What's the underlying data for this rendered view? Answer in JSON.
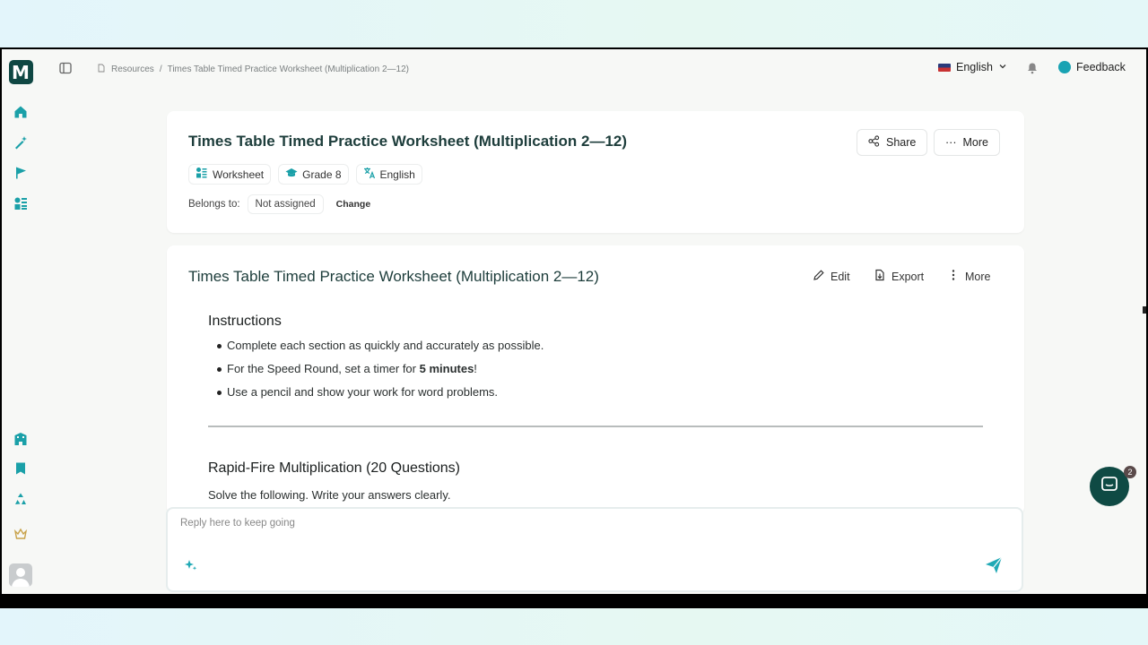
{
  "app": {
    "logo_letter": "M"
  },
  "breadcrumb": {
    "root": "Resources",
    "separator": "/",
    "current": "Times Table Timed Practice Worksheet (Multiplication 2—12)"
  },
  "topbar": {
    "language": "English",
    "feedback": "Feedback"
  },
  "resource_card": {
    "title": "Times Table Timed Practice Worksheet (Multiplication 2—12)",
    "share_label": "Share",
    "more_label": "More",
    "tags": [
      {
        "icon": "worksheet-icon",
        "label": "Worksheet"
      },
      {
        "icon": "graduation-cap-icon",
        "label": "Grade 8"
      },
      {
        "icon": "translate-icon",
        "label": "English"
      }
    ],
    "belongs_label": "Belongs to:",
    "belongs_value": "Not assigned",
    "change_label": "Change"
  },
  "document_card": {
    "title": "Times Table Timed Practice Worksheet (Multiplication 2—12)",
    "edit_label": "Edit",
    "export_label": "Export",
    "more_label": "More",
    "instructions_heading": "Instructions",
    "bullets": [
      {
        "text": "Complete each section as quickly and accurately as possible."
      },
      {
        "pre": "For the Speed Round, set a timer for ",
        "bold": "5 minutes",
        "post": "!"
      },
      {
        "text": "Use a pencil and show your work for word problems."
      }
    ],
    "section_heading": "Rapid-Fire Multiplication (20 Questions)",
    "section_sub": "Solve the following. Write your answers clearly."
  },
  "reply": {
    "placeholder": "Reply here to keep going"
  },
  "chat": {
    "badge_count": "2"
  },
  "colors": {
    "accent": "#1aa0a8",
    "brand_dark": "#0f4743"
  }
}
